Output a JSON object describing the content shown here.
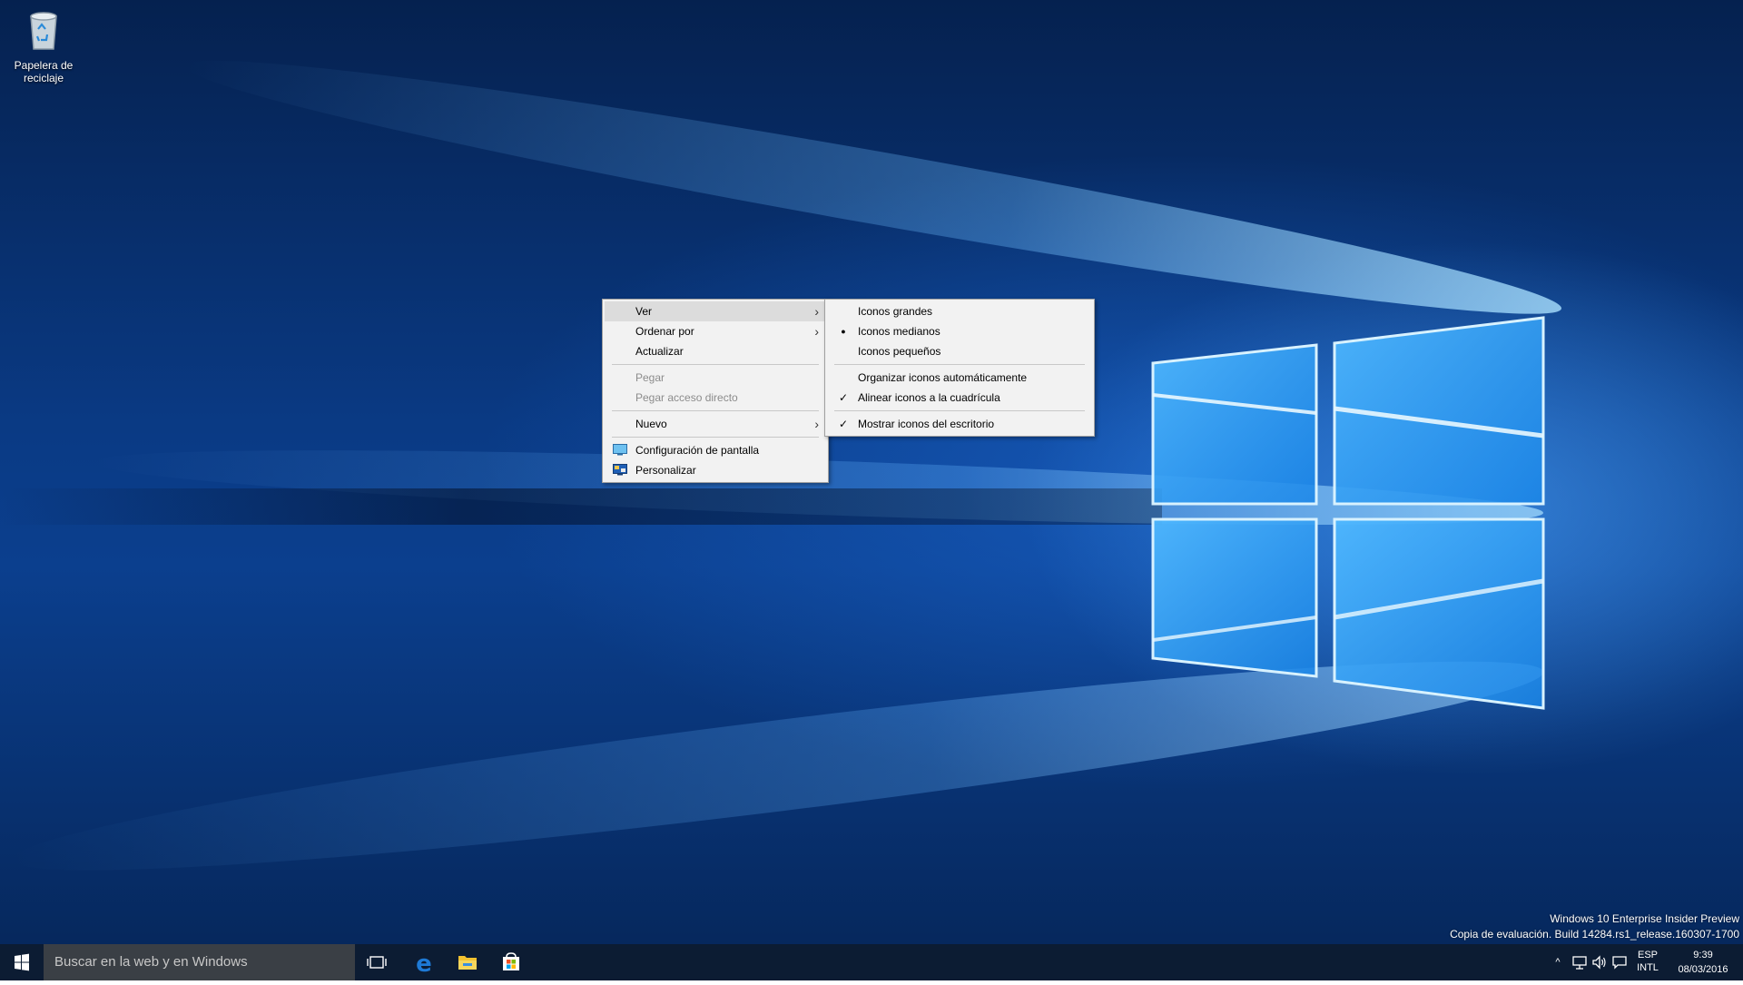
{
  "desktop": {
    "recycle_bin_label_line1": "Papelera de",
    "recycle_bin_label_line2": "reciclaje",
    "icon": "recycle-bin-icon"
  },
  "context_menu": {
    "items": [
      {
        "label": "Ver",
        "has_submenu": true,
        "highlighted": true
      },
      {
        "label": "Ordenar por",
        "has_submenu": true
      },
      {
        "label": "Actualizar"
      },
      {
        "label": "Pegar",
        "disabled": true
      },
      {
        "label": "Pegar acceso directo",
        "disabled": true
      },
      {
        "label": "Nuevo",
        "has_submenu": true
      },
      {
        "label": "Configuración de pantalla",
        "icon": "display-settings-icon"
      },
      {
        "label": "Personalizar",
        "icon": "personalize-icon"
      }
    ]
  },
  "view_submenu": {
    "items": [
      {
        "label": "Iconos grandes"
      },
      {
        "label": "Iconos medianos",
        "mark": "bullet"
      },
      {
        "label": "Iconos pequeños"
      },
      {
        "label": "Organizar iconos automáticamente"
      },
      {
        "label": "Alinear iconos a la cuadrícula",
        "mark": "check"
      },
      {
        "label": "Mostrar iconos del escritorio",
        "mark": "check"
      }
    ],
    "bullet_symbol": "●",
    "check_symbol": "✓"
  },
  "watermark": {
    "line1": "Windows 10 Enterprise Insider Preview",
    "line2": "Copia de evaluación. Build 14284.rs1_release.160307-1700"
  },
  "taskbar": {
    "search_placeholder": "Buscar en la web y en Windows",
    "pinned": [
      "task-view-icon",
      "edge-icon",
      "file-explorer-icon",
      "store-icon"
    ],
    "language_line1": "ESP",
    "language_line2": "INTL",
    "time": "9:39",
    "date": "08/03/2016",
    "tray_chevron": "^"
  },
  "colors": {
    "taskbar_bg": "#0c1c33",
    "search_bg": "#3a3f45",
    "menu_bg": "#f2f2f2",
    "menu_highlight": "#dcdcdc",
    "disabled_text": "#8c8c8c",
    "edge_blue": "#1e7ad6",
    "explorer_yellow": "#f2c230"
  }
}
